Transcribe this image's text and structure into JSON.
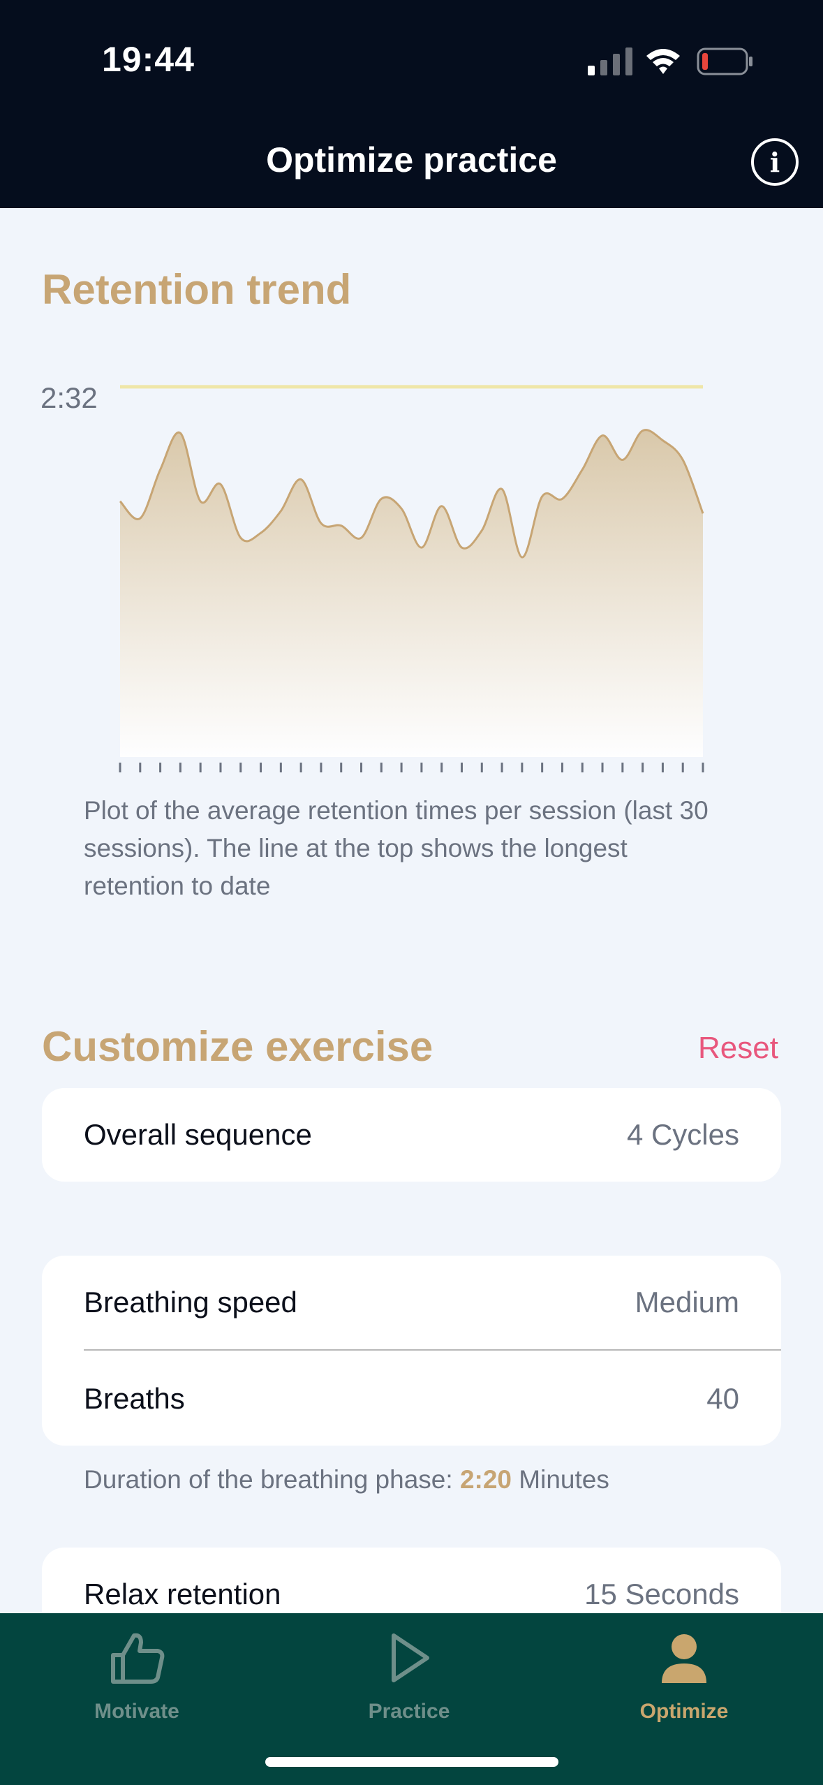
{
  "status_bar": {
    "time": "19:44"
  },
  "nav": {
    "title": "Optimize practice",
    "info_icon": "info-circle-icon"
  },
  "retention": {
    "title": "Retention trend",
    "max_label": "2:32",
    "caption": "Plot of the average retention times per session (last 30 sessions). The line at the top shows the longest retention to date"
  },
  "chart_data": {
    "type": "area",
    "x": [
      1,
      2,
      3,
      4,
      5,
      6,
      7,
      8,
      9,
      10,
      11,
      12,
      13,
      14,
      15,
      16,
      17,
      18,
      19,
      20,
      21,
      22,
      23,
      24,
      25,
      26,
      27,
      28,
      29,
      30
    ],
    "values": [
      105,
      98,
      118,
      133,
      105,
      112,
      90,
      92,
      101,
      114,
      96,
      95,
      90,
      106,
      102,
      86,
      103,
      86,
      93,
      110,
      82,
      107,
      106,
      118,
      132,
      122,
      134,
      130,
      122,
      100
    ],
    "max_line": 152,
    "max_line_label": "2:32",
    "ylim": [
      0,
      160
    ],
    "fill_color": "#d8c6a8",
    "line_color": "#c7a574",
    "max_line_color": "#efe6a8"
  },
  "customize": {
    "title": "Customize exercise",
    "reset_label": "Reset",
    "overall_sequence": {
      "label": "Overall sequence",
      "value": "4 Cycles"
    },
    "breathing_speed": {
      "label": "Breathing speed",
      "value": "Medium"
    },
    "breaths": {
      "label": "Breaths",
      "value": "40"
    },
    "duration_prefix": "Duration of the breathing phase:",
    "duration_value": "2:20",
    "duration_suffix": "Minutes",
    "relax_retention": {
      "label": "Relax retention",
      "value": "15 Seconds"
    }
  },
  "tabs": [
    {
      "label": "Motivate",
      "icon": "thumbs-up-icon",
      "active": false
    },
    {
      "label": "Practice",
      "icon": "play-icon",
      "active": false
    },
    {
      "label": "Optimize",
      "icon": "person-icon",
      "active": true
    }
  ],
  "colors": {
    "accent": "#c7a574",
    "reset": "#e8577d",
    "tabbar": "#03453f",
    "header": "#050d1d"
  }
}
